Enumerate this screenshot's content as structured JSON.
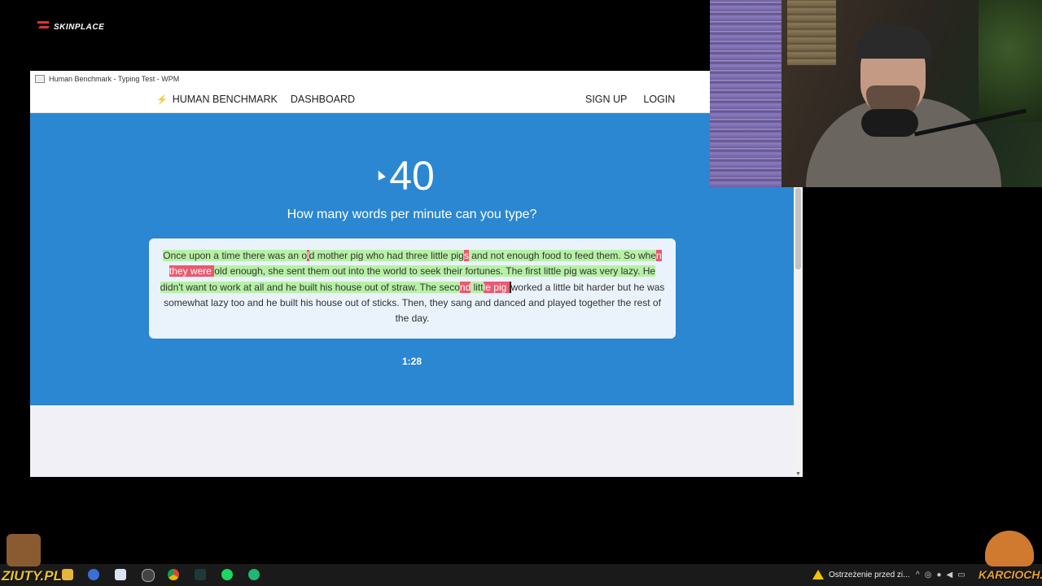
{
  "overlay": {
    "sponsor_logo": "SKINPLACE",
    "left_brand": "ZIUTY.PL",
    "right_brand": "KARCIOCH.PL"
  },
  "browser": {
    "window_title": "Human Benchmark - Typing Test - WPM"
  },
  "nav": {
    "brand": "HUMAN BENCHMARK",
    "dashboard": "DASHBOARD",
    "signup": "SIGN UP",
    "login": "LOGIN"
  },
  "typing_test": {
    "wpm": "40",
    "question": "How many words per minute can you type?",
    "timer": "1:28",
    "segments": [
      {
        "text": "Once upon a time there was an o",
        "state": "correct"
      },
      {
        "text": "l",
        "state": "error"
      },
      {
        "text": "d mother pig who had three little pig",
        "state": "correct"
      },
      {
        "text": "s",
        "state": "error"
      },
      {
        "text": " and not enough food to feed them. So whe",
        "state": "correct"
      },
      {
        "text": "n they were ",
        "state": "error"
      },
      {
        "text": "old enough, she sent them out into the world to seek their fortunes. The first little pig was very lazy. He didn't want to work at all and he built his house out of straw. The seco",
        "state": "correct"
      },
      {
        "text": "nd",
        "state": "error"
      },
      {
        "text": " litt",
        "state": "correct"
      },
      {
        "text": "le pig ",
        "state": "error"
      },
      {
        "text": "worked a little bit harder but he was somewhat lazy too and he built his house out of sticks. Then, they sang and danced and played together the rest of the day.",
        "state": "pending"
      }
    ]
  },
  "taskbar": {
    "warning_text": "Ostrzeżenie przed zi...",
    "icons": [
      "file-explorer-icon",
      "browser-icon",
      "calendar-icon",
      "obs-icon",
      "chrome-icon",
      "audio-app-icon",
      "spotify-icon",
      "app-icon"
    ]
  },
  "colors": {
    "hero_blue": "#2b87d1",
    "correct_bg": "#b6f1a5",
    "error_bg": "#e85a6f"
  }
}
